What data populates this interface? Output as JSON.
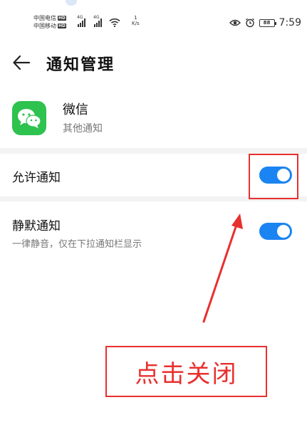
{
  "status_bar": {
    "carrier1": "中国电信",
    "carrier2": "中国移动",
    "hd_badge": "HD",
    "network_tag": "4G",
    "speed_value": "1",
    "speed_unit": "K/s",
    "battery": "88",
    "time": "7:59"
  },
  "header": {
    "title": "通知管理"
  },
  "app": {
    "name": "微信",
    "category": "其他通知",
    "brand_color": "#2ec24e"
  },
  "settings": {
    "allow_notifications": {
      "label": "允许通知",
      "enabled": true
    },
    "silent_notifications": {
      "label": "静默通知",
      "description": "一律静音，仅在下拉通知栏显示",
      "enabled": true
    }
  },
  "annotation": {
    "callout": "点击关闭",
    "color": "#e8302e"
  },
  "colors": {
    "toggle_on": "#1a84f2",
    "divider": "#f3f3f3"
  }
}
